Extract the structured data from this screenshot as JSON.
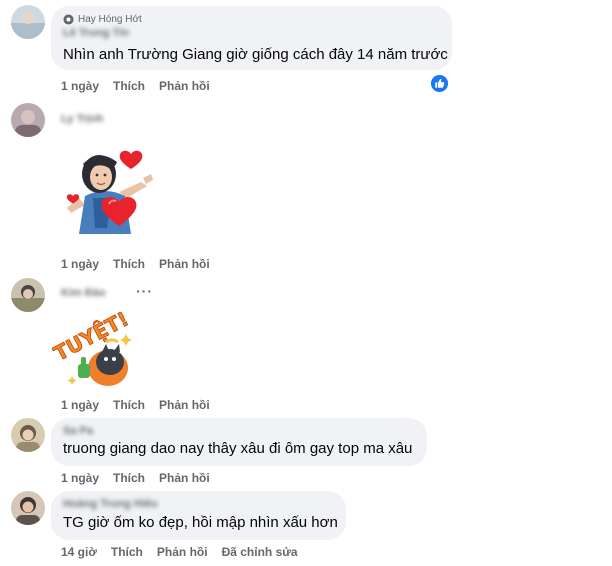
{
  "comments": [
    {
      "fan_badge": "Hay Hóng Hớt",
      "author": "Lê Trung Tín",
      "text": "Nhìn anh Trường Giang giờ giống cách đây 14 năm trước",
      "time": "1 ngày",
      "like_label": "Thích",
      "reply_label": "Phản hồi",
      "reaction": "like-icon"
    },
    {
      "author": "Ly Trịnh",
      "sticker": "avatar-hearts-sticker",
      "time": "1 ngày",
      "like_label": "Thích",
      "reply_label": "Phản hồi"
    },
    {
      "author": "Kim Đào",
      "sticker": "tuyet-sticker",
      "sticker_text": "TUYỆT!",
      "more": "···",
      "time": "1 ngày",
      "like_label": "Thích",
      "reply_label": "Phản hồi"
    },
    {
      "author": "Sa Pa",
      "text": "truong giang dao nay thây xâu đi ôm gay top ma xâu",
      "time": "1 ngày",
      "like_label": "Thích",
      "reply_label": "Phản hồi"
    },
    {
      "author": "Hoàng Trung Hiếu",
      "text": "TG giờ ốm ko đẹp, hồi mập nhìn xấu hơn",
      "time": "14 giờ",
      "like_label": "Thích",
      "reply_label": "Phản hồi",
      "edited_label": "Đã chỉnh sửa"
    }
  ],
  "colors": {
    "bubble": "#f0f2f5",
    "secondary_text": "#65676b",
    "like_blue": "#1877f2",
    "heart_red": "#e8232c"
  }
}
